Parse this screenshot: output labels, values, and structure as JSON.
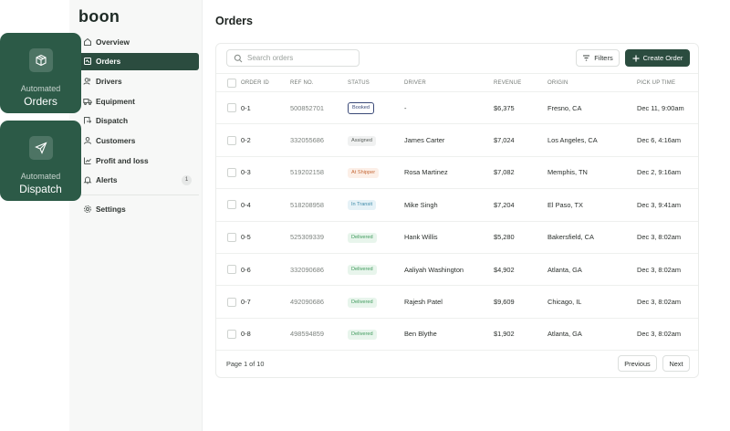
{
  "promos": [
    {
      "small": "Automated",
      "big": "Orders",
      "icon": "package-icon"
    },
    {
      "small": "Automated",
      "big": "Dispatch",
      "icon": "send-icon"
    }
  ],
  "sidebar": {
    "logo": "boon",
    "items": [
      {
        "label": "Overview",
        "icon": "home-icon"
      },
      {
        "label": "Orders",
        "icon": "orders-icon",
        "active": true
      },
      {
        "label": "Drivers",
        "icon": "users-icon"
      },
      {
        "label": "Equipment",
        "icon": "truck-icon"
      },
      {
        "label": "Dispatch",
        "icon": "dispatch-icon"
      },
      {
        "label": "Customers",
        "icon": "customers-icon"
      },
      {
        "label": "Profit and loss",
        "icon": "chart-icon"
      },
      {
        "label": "Alerts",
        "icon": "bell-icon",
        "badge": "1"
      },
      {
        "label": "Settings",
        "icon": "gear-icon"
      }
    ]
  },
  "main": {
    "title": "Orders",
    "search_placeholder": "Search orders",
    "filters_label": "Filters",
    "create_label": "Create Order",
    "columns": [
      "ORDER ID",
      "REF NO.",
      "STATUS",
      "DRIVER",
      "REVENUE",
      "ORIGIN",
      "PICK UP TIME"
    ],
    "rows": [
      {
        "id": "0-1",
        "ref": "500852701",
        "status": "Booked",
        "status_kind": "booked",
        "driver": "-",
        "revenue": "$6,375",
        "origin": "Fresno, CA",
        "pickup": "Dec 11, 9:00am"
      },
      {
        "id": "0-2",
        "ref": "332055686",
        "status": "Assigned",
        "status_kind": "assigned",
        "driver": "James Carter",
        "revenue": "$7,024",
        "origin": "Los Angeles, CA",
        "pickup": "Dec 6, 4:16am"
      },
      {
        "id": "0-3",
        "ref": "519202158",
        "status": "At Shipper",
        "status_kind": "shipper",
        "driver": "Rosa Martinez",
        "revenue": "$7,082",
        "origin": "Memphis, TN",
        "pickup": "Dec 2, 9:16am"
      },
      {
        "id": "0-4",
        "ref": "518208958",
        "status": "In Transit",
        "status_kind": "transit",
        "driver": "Mike Singh",
        "revenue": "$7,204",
        "origin": "El Paso, TX",
        "pickup": "Dec 3, 9:41am"
      },
      {
        "id": "0-5",
        "ref": "525309339",
        "status": "Delivered",
        "status_kind": "delivered",
        "driver": "Hank Willis",
        "revenue": "$5,280",
        "origin": "Bakersfield, CA",
        "pickup": "Dec 3, 8:02am"
      },
      {
        "id": "0-6",
        "ref": "332090686",
        "status": "Delivered",
        "status_kind": "delivered",
        "driver": "Aaliyah Washington",
        "revenue": "$4,902",
        "origin": "Atlanta, GA",
        "pickup": "Dec 3, 8:02am"
      },
      {
        "id": "0-7",
        "ref": "492090686",
        "status": "Delivered",
        "status_kind": "delivered",
        "driver": "Rajesh Patel",
        "revenue": "$9,609",
        "origin": "Chicago, IL",
        "pickup": "Dec 3, 8:02am"
      },
      {
        "id": "0-8",
        "ref": "498594859",
        "status": "Delivered",
        "status_kind": "delivered",
        "driver": "Ben Blythe",
        "revenue": "$1,902",
        "origin": "Atlanta, GA",
        "pickup": "Dec 3, 8:02am"
      }
    ],
    "pagination": {
      "text": "Page 1 of 10",
      "previous": "Previous",
      "next": "Next"
    }
  },
  "colors": {
    "brand": "#2b4c3f",
    "promo": "#2c5a47"
  }
}
